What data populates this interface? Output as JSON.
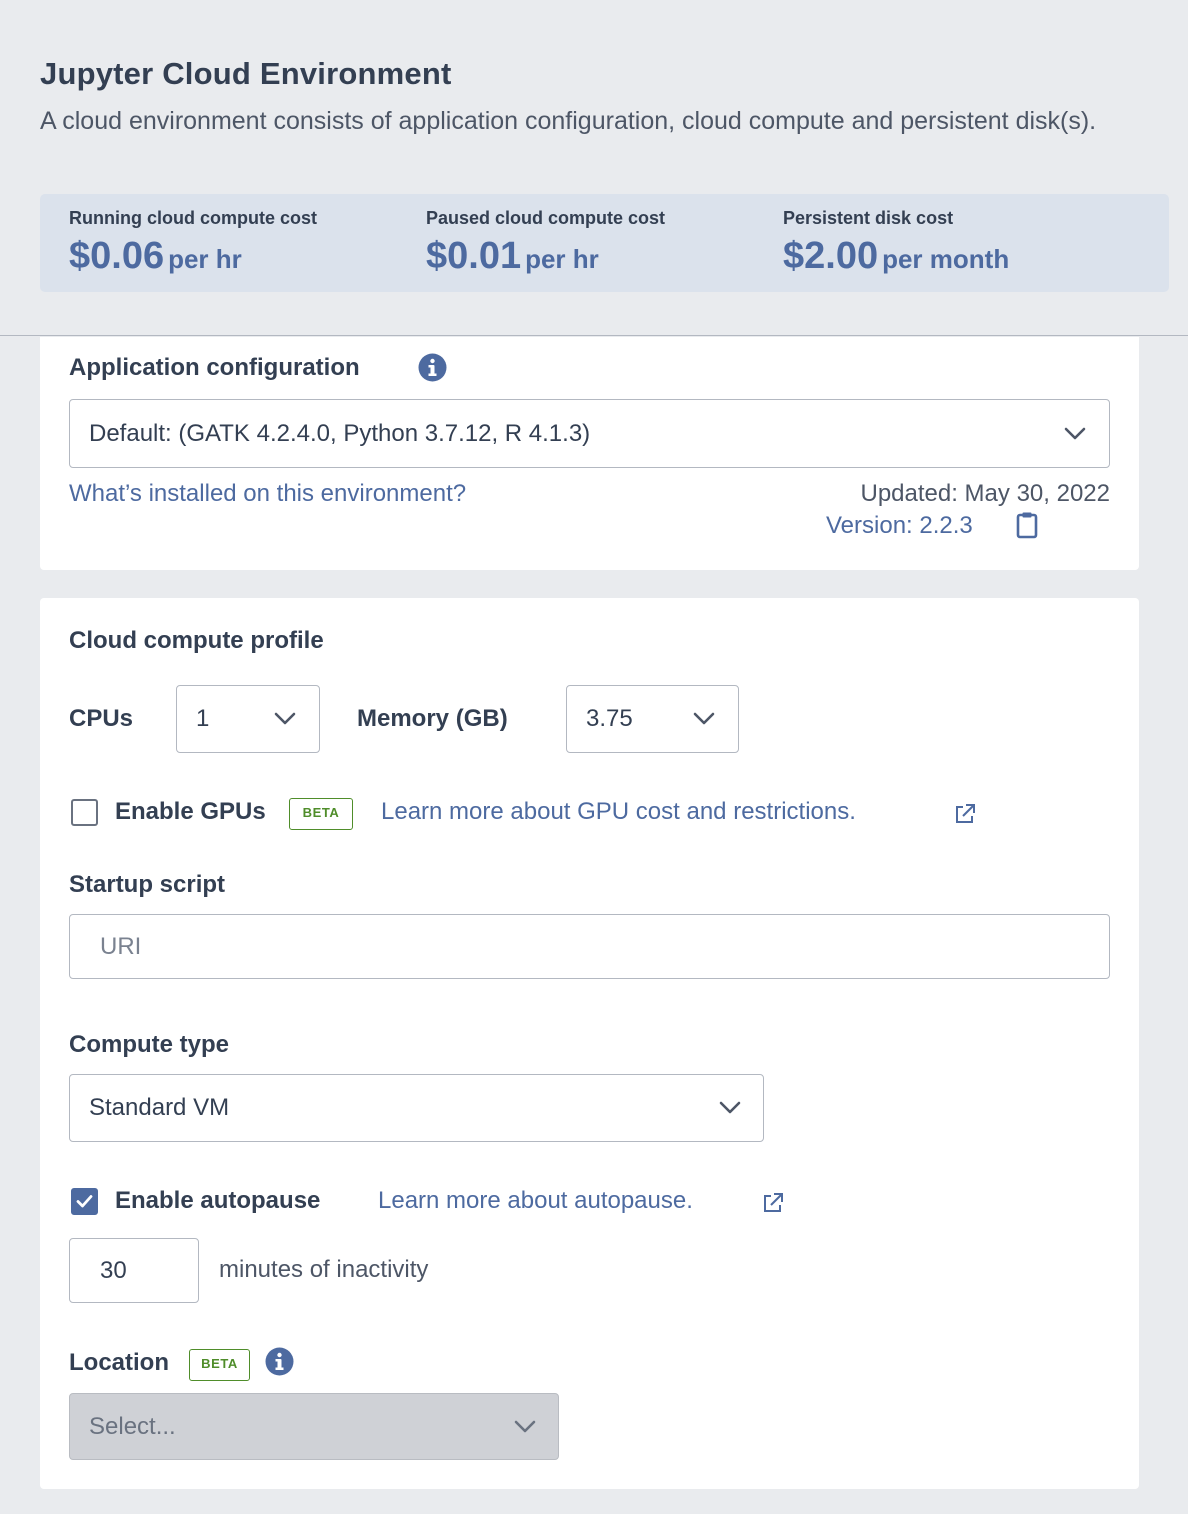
{
  "header": {
    "title": "Jupyter Cloud Environment",
    "subtitle": "A cloud environment consists of application configuration, cloud compute and persistent disk(s)."
  },
  "costs": [
    {
      "label": "Running cloud compute cost",
      "amount": "$0.06",
      "unit": "per hr"
    },
    {
      "label": "Paused cloud compute cost",
      "amount": "$0.01",
      "unit": "per hr"
    },
    {
      "label": "Persistent disk cost",
      "amount": "$2.00",
      "unit": "per month"
    }
  ],
  "app_config": {
    "label": "Application configuration",
    "selected": "Default: (GATK 4.2.4.0, Python 3.7.12, R 4.1.3)",
    "whats_installed_link": "What’s installed on this environment?",
    "updated": "Updated: May 30, 2022",
    "version": "Version: 2.2.3"
  },
  "compute": {
    "title": "Cloud compute profile",
    "cpus_label": "CPUs",
    "cpus_value": "1",
    "memory_label": "Memory (GB)",
    "memory_value": "3.75",
    "gpu_label": "Enable GPUs",
    "gpu_checked": false,
    "beta_badge": "BETA",
    "gpu_link": "Learn more about GPU cost and restrictions.",
    "startup_label": "Startup script",
    "startup_placeholder": "URI",
    "compute_type_label": "Compute type",
    "compute_type_value": "Standard VM",
    "autopause_label": "Enable autopause",
    "autopause_checked": true,
    "autopause_link": "Learn more about autopause.",
    "autopause_minutes": "30",
    "autopause_suffix": "minutes of inactivity",
    "location_label": "Location",
    "location_placeholder": "Select..."
  },
  "colors": {
    "accent": "#4d6aa0",
    "beta": "#4f8d2a",
    "background": "#e9ebee",
    "cost_box": "#dbe2ec"
  }
}
